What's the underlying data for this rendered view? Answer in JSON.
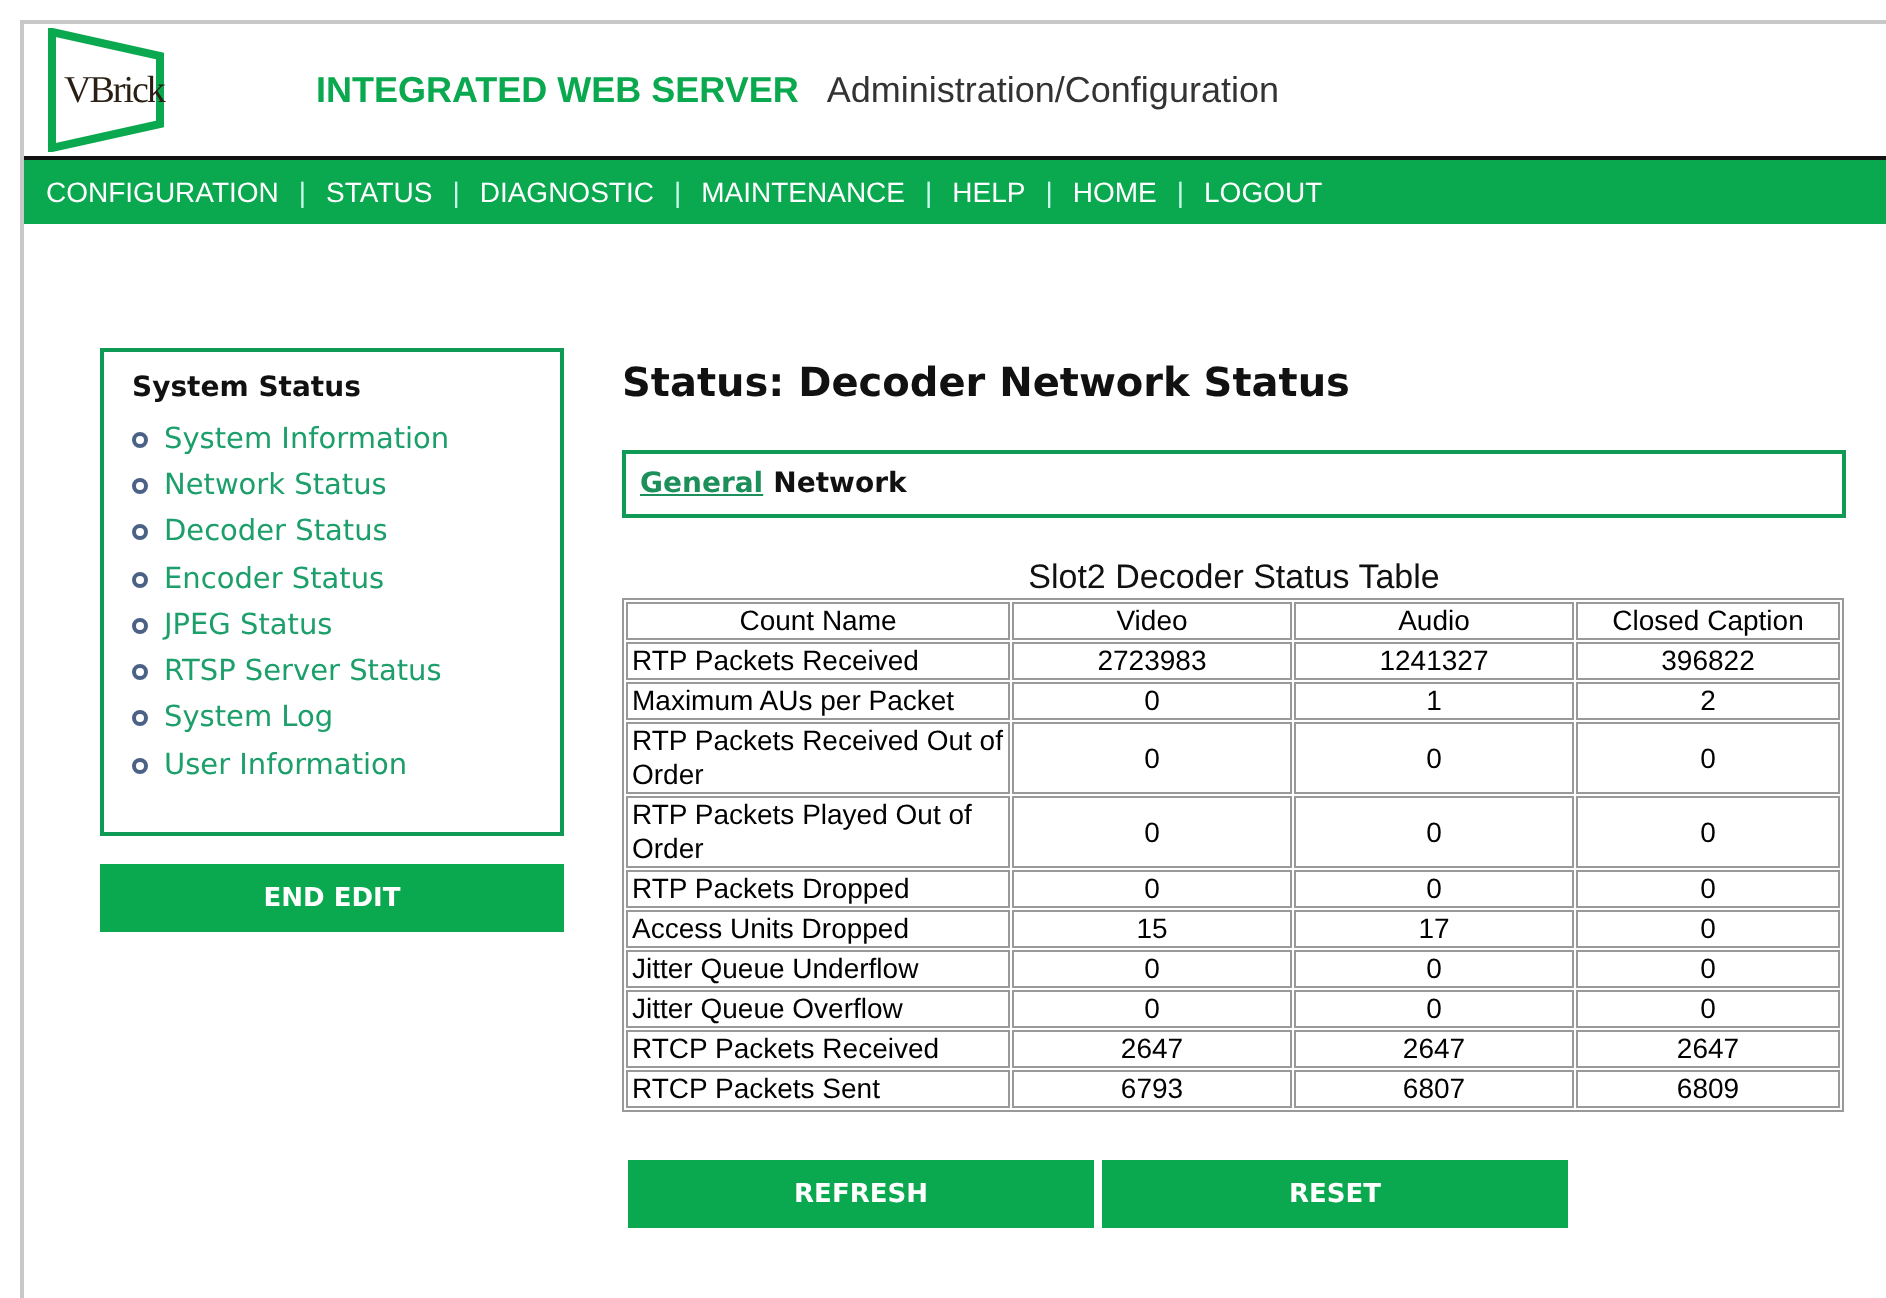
{
  "header": {
    "logo": "VBrick",
    "product": "INTEGRATED WEB SERVER",
    "subtitle": "Administration/Configuration"
  },
  "nav": {
    "separator": "|",
    "items": [
      "CONFIGURATION",
      "STATUS",
      "DIAGNOSTIC",
      "MAINTENANCE",
      "HELP",
      "HOME",
      "LOGOUT"
    ]
  },
  "sidebar": {
    "title": "System Status",
    "items": [
      "System Information",
      "Network Status",
      "Decoder Status",
      "Encoder Status",
      "JPEG Status",
      "RTSP Server Status",
      "System Log",
      "User Information"
    ],
    "button": "END EDIT"
  },
  "page_title": "Status: Decoder Network Status",
  "tabs": [
    {
      "label": "General",
      "selected": false
    },
    {
      "label": "Network",
      "selected": true
    }
  ],
  "table": {
    "caption": "Slot2 Decoder Status Table",
    "columns": [
      "Count Name",
      "Video",
      "Audio",
      "Closed Caption"
    ],
    "rows": [
      [
        "RTP Packets Received",
        "2723983",
        "1241327",
        "396822"
      ],
      [
        "Maximum AUs per Packet",
        "0",
        "1",
        "2"
      ],
      [
        "RTP Packets Received Out of Order",
        "0",
        "0",
        "0"
      ],
      [
        "RTP Packets Played Out of Order",
        "0",
        "0",
        "0"
      ],
      [
        "RTP Packets Dropped",
        "0",
        "0",
        "0"
      ],
      [
        "Access Units Dropped",
        "15",
        "17",
        "0"
      ],
      [
        "Jitter Queue Underflow",
        "0",
        "0",
        "0"
      ],
      [
        "Jitter Queue Overflow",
        "0",
        "0",
        "0"
      ],
      [
        "RTCP Packets Received",
        "2647",
        "2647",
        "2647"
      ],
      [
        "RTCP Packets Sent",
        "6793",
        "6807",
        "6809"
      ]
    ]
  },
  "buttons": [
    "REFRESH",
    "RESET"
  ]
}
